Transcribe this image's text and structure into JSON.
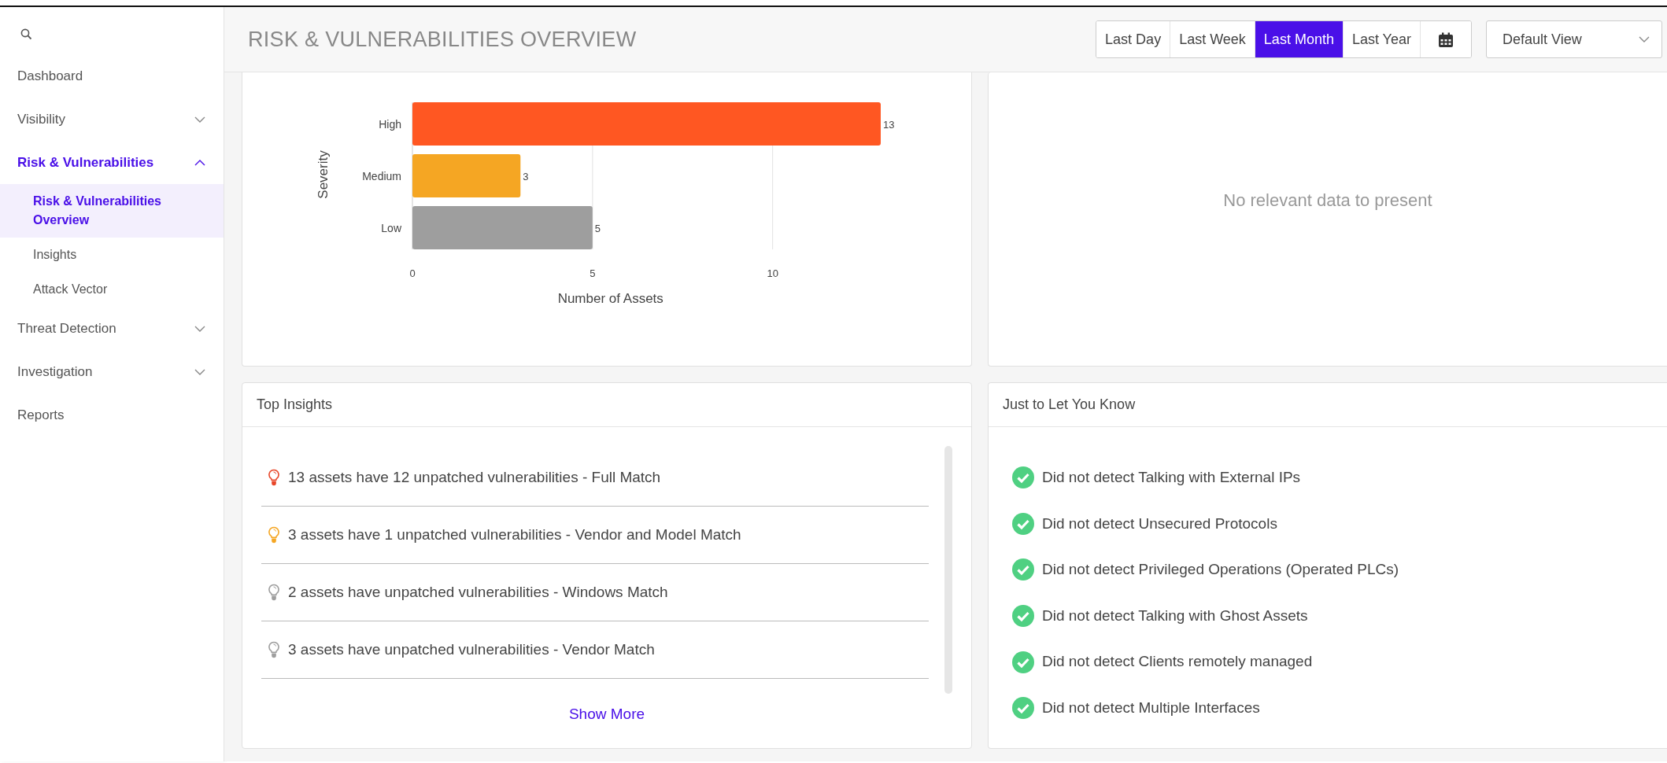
{
  "sidebar": {
    "items": [
      {
        "kind": "link",
        "label": "Dashboard",
        "selected": false
      },
      {
        "kind": "group",
        "label": "Visibility",
        "selected": false,
        "expanded": false
      },
      {
        "kind": "group",
        "label": "Risk & Vulnerabilities",
        "selected": true,
        "expanded": true,
        "children": [
          {
            "label": "Risk & Vulnerabilities Overview",
            "selected": true
          },
          {
            "label": "Insights",
            "selected": false
          },
          {
            "label": "Attack Vector",
            "selected": false
          }
        ]
      },
      {
        "kind": "group",
        "label": "Threat Detection",
        "selected": false,
        "expanded": false
      },
      {
        "kind": "group",
        "label": "Investigation",
        "selected": false,
        "expanded": false
      },
      {
        "kind": "link",
        "label": "Reports",
        "selected": false
      }
    ]
  },
  "header": {
    "title": "RISK & VULNERABILITIES OVERVIEW",
    "time_ranges": [
      {
        "label": "Last Day",
        "selected": false
      },
      {
        "label": "Last Week",
        "selected": false
      },
      {
        "label": "Last Month",
        "selected": true
      },
      {
        "label": "Last Year",
        "selected": false
      }
    ],
    "view_select": {
      "value": "Default View"
    }
  },
  "severity_card": {
    "chart_data": {
      "type": "bar",
      "orientation": "horizontal",
      "xlabel": "Number of Assets",
      "ylabel": "Severity",
      "categories": [
        "High",
        "Medium",
        "Low"
      ],
      "values": [
        13,
        3,
        5
      ],
      "colors": [
        "#ff5722",
        "#f5a623",
        "#9e9e9e"
      ],
      "xlim": [
        0,
        13
      ],
      "xticks": [
        0,
        5,
        10
      ],
      "data_labels": true
    }
  },
  "empty_card": {
    "message": "No relevant data to present"
  },
  "top_insights": {
    "title": "Top Insights",
    "items": [
      {
        "text": "13 assets have 12 unpatched vulnerabilities - Full Match",
        "color": "#e8472a"
      },
      {
        "text": "3 assets have 1 unpatched vulnerabilities - Vendor and Model Match",
        "color": "#f5a623"
      },
      {
        "text": "2 assets have unpatched vulnerabilities - Windows Match",
        "color": "#9e9e9e"
      },
      {
        "text": "3 assets have unpatched vulnerabilities - Vendor Match",
        "color": "#9e9e9e"
      }
    ],
    "show_more": "Show More"
  },
  "just_to_know": {
    "title": "Just to Let You Know",
    "items": [
      {
        "text": "Did not detect Talking with External IPs"
      },
      {
        "text": "Did not detect Unsecured Protocols"
      },
      {
        "text": "Did not detect Privileged Operations (Operated PLCs)"
      },
      {
        "text": "Did not detect Talking with Ghost Assets"
      },
      {
        "text": "Did not detect Clients remotely managed"
      },
      {
        "text": "Did not detect Multiple Interfaces"
      }
    ]
  }
}
